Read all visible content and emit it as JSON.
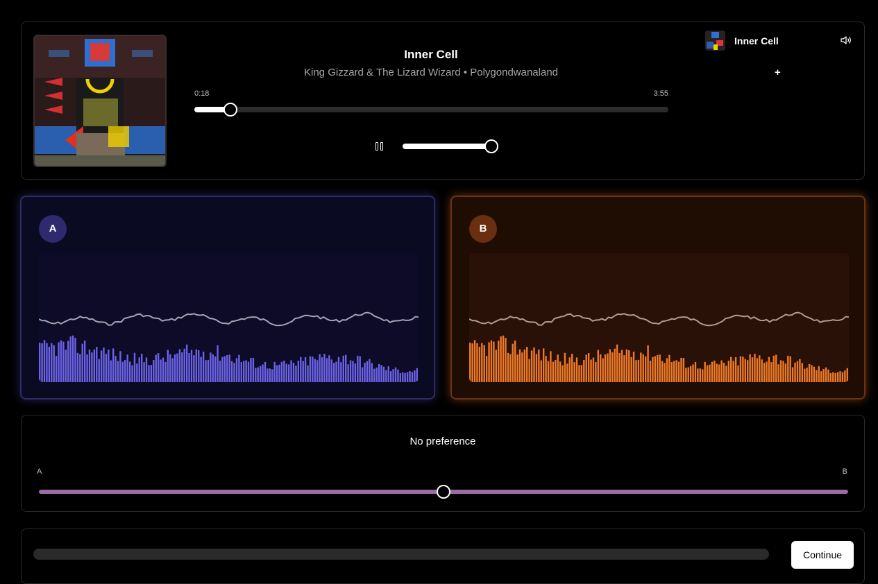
{
  "player": {
    "title": "Inner Cell",
    "subtitle": "King Gizzard & The Lizard Wizard • Polygondwanaland",
    "time_elapsed": "0:18",
    "time_total": "3:55",
    "progress": 0.0766,
    "volume": 1.0,
    "pause_icon": "pause-icon",
    "add_label": "+"
  },
  "queue": {
    "title": "Inner Cell",
    "volume_icon": "volume-icon"
  },
  "cards": {
    "a": {
      "label": "A",
      "accent": "#6b63e8",
      "line": "#a5a3b5"
    },
    "b": {
      "label": "B",
      "accent": "#f07a27",
      "line": "#b39b8f"
    }
  },
  "preference": {
    "label": "No preference",
    "left_label": "A",
    "right_label": "B",
    "value": 0.5,
    "track_color": "#9b6ba6"
  },
  "footer": {
    "continue_label": "Continue"
  }
}
